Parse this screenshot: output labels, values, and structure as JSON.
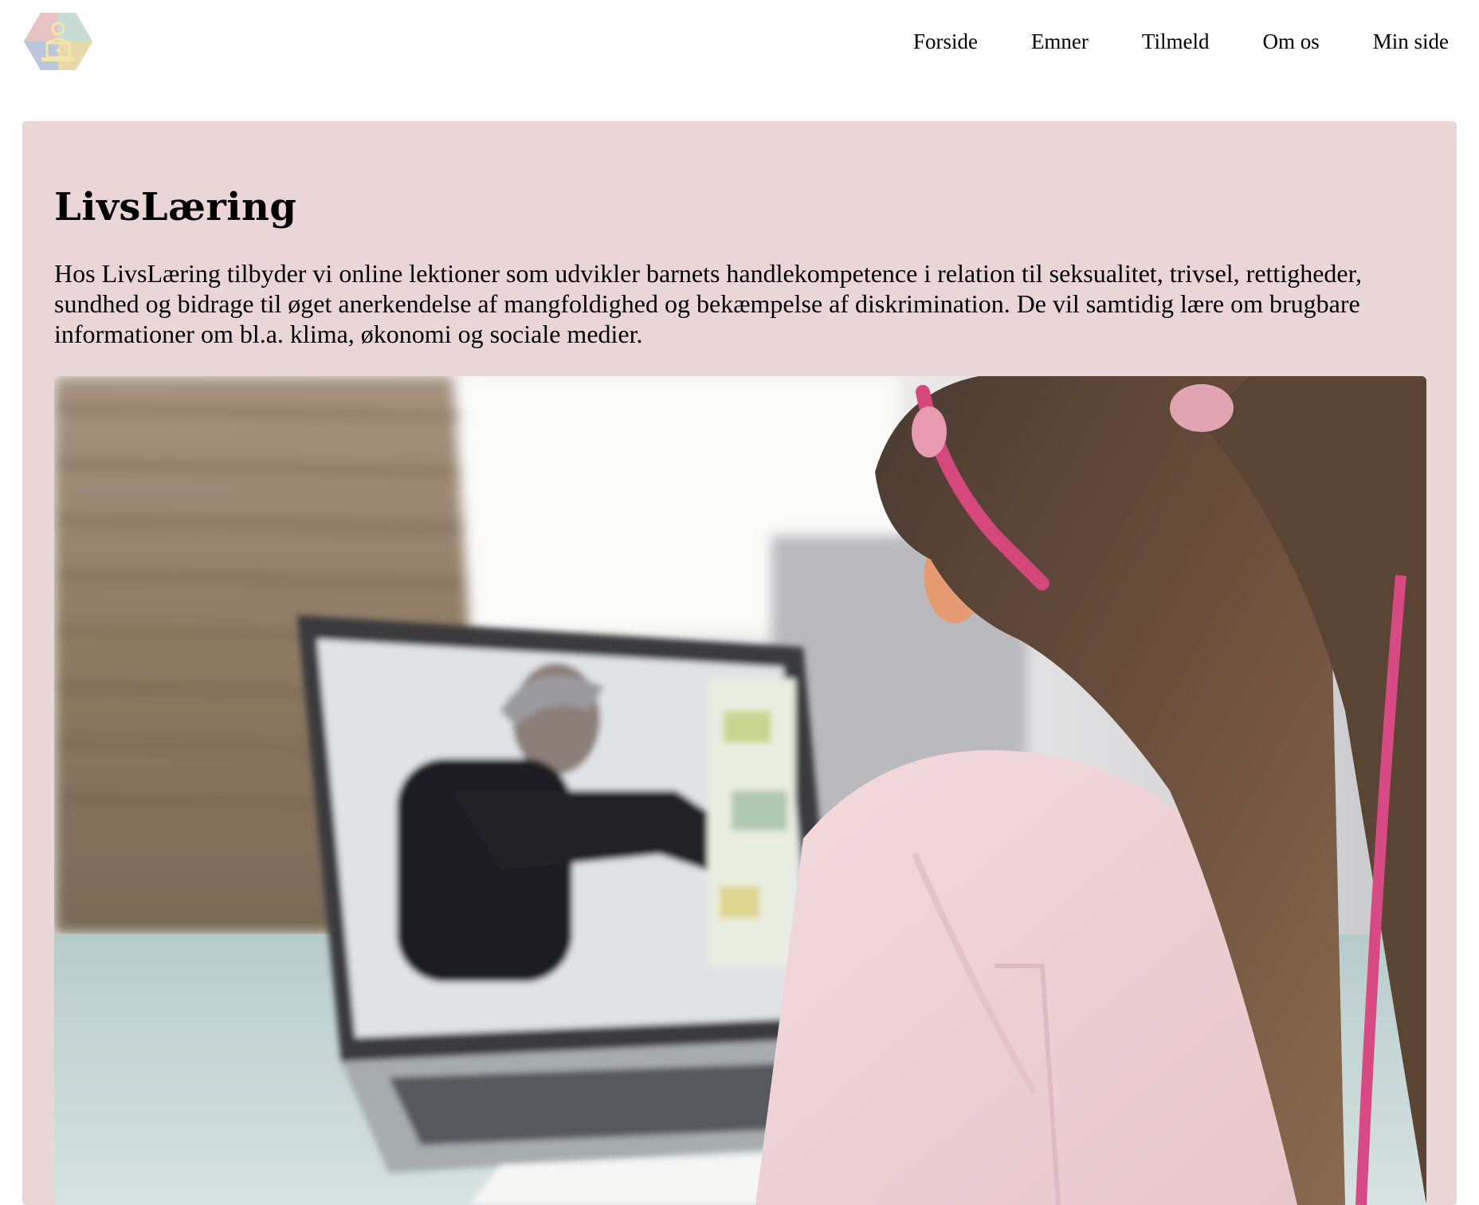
{
  "header": {
    "logo_icon": "laptop-person-hexagon-logo",
    "nav": [
      {
        "label": "Forside"
      },
      {
        "label": "Emner"
      },
      {
        "label": "Tilmeld"
      },
      {
        "label": "Om os"
      },
      {
        "label": "Min side"
      }
    ]
  },
  "hero": {
    "title": "LivsLæring",
    "intro": "Hos LivsLæring tilbyder vi online lektioner som udvikler barnets handlekompetence i relation til seksualitet, trivsel, rettigheder, sundhed og bidrage til øget anerkendelse af mangfoldighed og bekæmpelse af diskrimination. De vil samtidig lære om brugbare informationer om bl.a. klima, økonomi og sociale medier.",
    "background_color": "#ebd6d7",
    "image_subject": "girl-watching-teacher-on-laptop"
  }
}
